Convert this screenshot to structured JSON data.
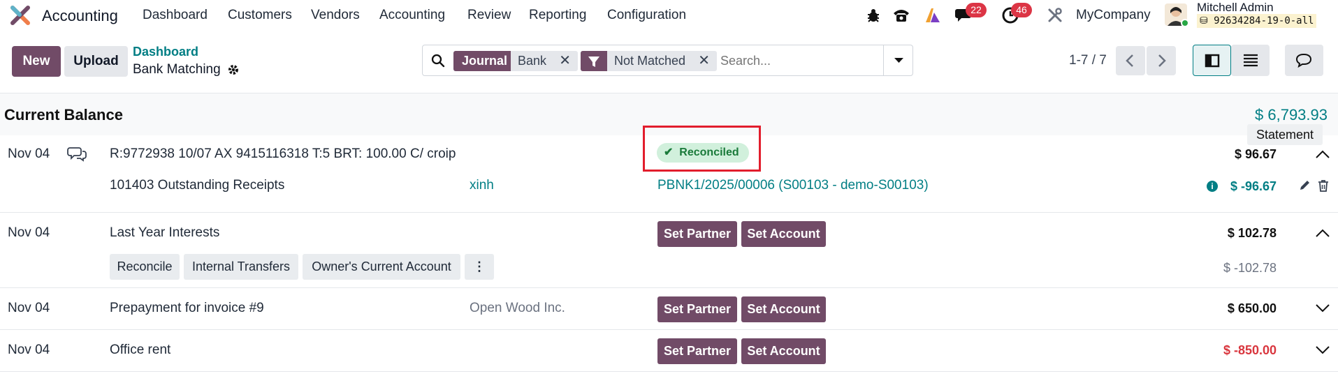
{
  "navbar": {
    "app_name": "Accounting",
    "menus": [
      "Dashboard",
      "Customers",
      "Vendors",
      "Accounting",
      "Review",
      "Reporting",
      "Configuration"
    ],
    "messages_count": "22",
    "activities_count": "46",
    "company": "MyCompany",
    "user_name": "Mitchell Admin",
    "db_name": "92634284-19-0-all"
  },
  "control_panel": {
    "new_label": "New",
    "upload_label": "Upload",
    "breadcrumb_parent": "Dashboard",
    "breadcrumb_current": "Bank Matching",
    "search": {
      "facets": [
        {
          "label": "Journal",
          "value": "Bank"
        },
        {
          "label": "",
          "value": "Not Matched"
        }
      ],
      "placeholder": "Search..."
    },
    "pager": "1-7 / 7"
  },
  "balance": {
    "label": "Current Balance",
    "value": "$ 6,793.93",
    "tooltip": "Statement"
  },
  "lines": [
    {
      "date": "Nov 04",
      "label": "R:9772938 10/07 AX 9415116318 T:5 BRT: 100.00 C/ croip",
      "status": "Reconciled",
      "amount": "$ 96.67",
      "sub": {
        "account": "101403 Outstanding Receipts",
        "partner": "xinh",
        "ref": "PBNK1/2025/00006 (S00103 - demo-S00103)",
        "amount": "$ -96.67"
      }
    },
    {
      "date": "Nov 04",
      "label": "Last Year Interests",
      "amount": "$ 102.78",
      "actions": [
        "Set Partner",
        "Set Account"
      ],
      "suggestions": [
        "Reconcile",
        "Internal Transfers",
        "Owner's Current Account"
      ],
      "residual": "$ -102.78"
    },
    {
      "date": "Nov 04",
      "label": "Prepayment for invoice #9",
      "partner": "Open Wood Inc.",
      "amount": "$ 650.00",
      "actions": [
        "Set Partner",
        "Set Account"
      ]
    },
    {
      "date": "Nov 04",
      "label": "Office rent",
      "amount": "$ -850.00",
      "actions": [
        "Set Partner",
        "Set Account"
      ]
    }
  ],
  "colors": {
    "brand": "#714b67",
    "link": "#017e84",
    "danger": "#d9363e",
    "success_bg": "#d1f0dc",
    "success_text": "#1a7a3a",
    "highlight": "#e21d2c"
  }
}
